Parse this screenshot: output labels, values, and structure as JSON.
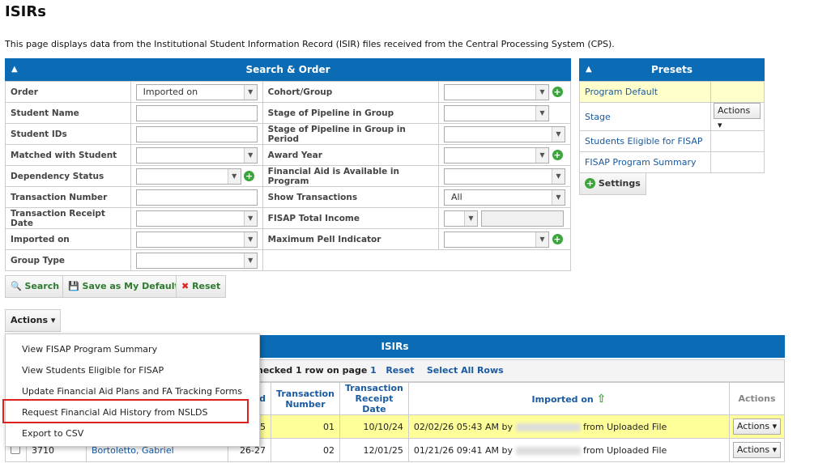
{
  "page": {
    "title": "ISIRs",
    "description": "This page displays data from the Institutional Student Information Record (ISIR) files received from the Central Processing System (CPS)."
  },
  "search_panel": {
    "title": "Search & Order",
    "fields": {
      "order_label": "Order",
      "order_value": "Imported on",
      "student_name_label": "Student Name",
      "student_ids_label": "Student IDs",
      "matched_label": "Matched with Student",
      "dependency_label": "Dependency Status",
      "transaction_number_label": "Transaction Number",
      "transaction_receipt_label": "Transaction Receipt Date",
      "imported_on_label": "Imported on",
      "group_type_label": "Group Type",
      "cohort_label": "Cohort/Group",
      "stage_label": "Stage of Pipeline in Group",
      "stage_period_label": "Stage of Pipeline in Group in Period",
      "award_year_label": "Award Year",
      "fa_available_label": "Financial Aid is Available in Program",
      "show_transactions_label": "Show Transactions",
      "show_transactions_value": "All",
      "fisap_label": "FISAP Total Income",
      "pell_label": "Maximum Pell Indicator"
    },
    "buttons": {
      "search": "Search",
      "save_default": "Save as My Default",
      "reset": "Reset"
    }
  },
  "presets": {
    "title": "Presets",
    "items": [
      "Program Default",
      "Stage",
      "Students Eligible for FISAP",
      "FISAP Program Summary"
    ],
    "actions_label": "Actions",
    "settings_label": "Settings"
  },
  "actions_menu": {
    "button_label": "Actions",
    "items": [
      "View FISAP Program Summary",
      "View Students Eligible for FISAP",
      "Update Financial Aid Plans and FA Tracking Forms",
      "Request Financial Aid History from NSLDS",
      "Export to CSV"
    ]
  },
  "isirs_grid": {
    "title": "ISIRs",
    "selection_text_prefix": "hecked 1 row on page",
    "selection_page": "1",
    "reset_link": "Reset",
    "select_all_link": "Select All Rows",
    "headers": {
      "award_year_partial": "d",
      "transaction_number": "Transaction Number",
      "receipt_date": "Transaction Receipt Date",
      "imported_on": "Imported on",
      "actions": "Actions"
    },
    "rows": [
      {
        "id": "",
        "name": "",
        "year": "5",
        "txn": "01",
        "receipt": "10/10/24",
        "imported": "02/02/26 05:43 AM by",
        "source": "from Uploaded File",
        "action": "Actions"
      },
      {
        "id": "3710",
        "name": "Bortoletto, Gabriel",
        "year": "26-27",
        "txn": "02",
        "receipt": "12/01/25",
        "imported": "01/21/26 09:41 AM by",
        "source": "from Uploaded File",
        "action": "Actions"
      }
    ]
  },
  "colors": {
    "header_blue": "#0b6bb5",
    "highlight_yellow": "#ffffcc",
    "link_blue": "#1a5aa0",
    "menu_highlight_border": "#e02020"
  }
}
